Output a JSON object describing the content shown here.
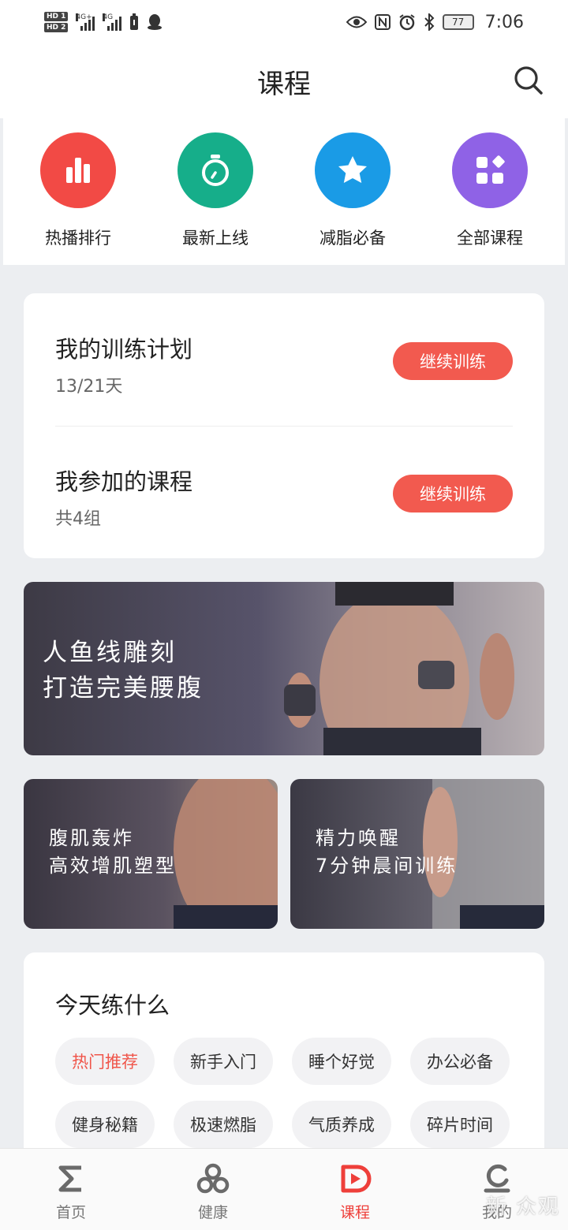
{
  "status": {
    "sim1": "HD 1",
    "sim2": "HD 2",
    "net1": "4G+",
    "net2": "4G",
    "battery": "77",
    "time": "7:06"
  },
  "header": {
    "title": "课程"
  },
  "quick": [
    {
      "label": "热播排行",
      "color": "#f24a45",
      "icon": "bar-chart-icon"
    },
    {
      "label": "最新上线",
      "color": "#16ae8a",
      "icon": "stopwatch-icon"
    },
    {
      "label": "减脂必备",
      "color": "#1a9be6",
      "icon": "star-icon"
    },
    {
      "label": "全部课程",
      "color": "#8f62e6",
      "icon": "grid-icon"
    }
  ],
  "plan": {
    "rows": [
      {
        "title": "我的训练计划",
        "sub": "13/21天",
        "button": "继续训练"
      },
      {
        "title": "我参加的课程",
        "sub": "共4组",
        "button": "继续训练"
      }
    ]
  },
  "banners": {
    "big": {
      "line1": "人鱼线雕刻",
      "line2": "打造完美腰腹"
    },
    "small1": {
      "line1": "腹肌轰炸",
      "line2": "高效增肌塑型"
    },
    "small2": {
      "line1": "精力唤醒",
      "line2": "7分钟晨间训练"
    }
  },
  "today": {
    "title": "今天练什么",
    "chips": [
      "热门推荐",
      "新手入门",
      "睡个好觉",
      "办公必备",
      "健身秘籍",
      "极速燃脂",
      "气质养成",
      "碎片时间"
    ],
    "active_index": 0
  },
  "tabs": [
    {
      "label": "首页",
      "icon": "sigma-icon"
    },
    {
      "label": "健康",
      "icon": "health-icon"
    },
    {
      "label": "课程",
      "icon": "course-play-icon",
      "active": true
    },
    {
      "label": "我的",
      "icon": "profile-icon"
    }
  ],
  "watermark": "新 众观",
  "colors": {
    "accent": "#f25a4f",
    "active_tab": "#ee3f3a"
  }
}
